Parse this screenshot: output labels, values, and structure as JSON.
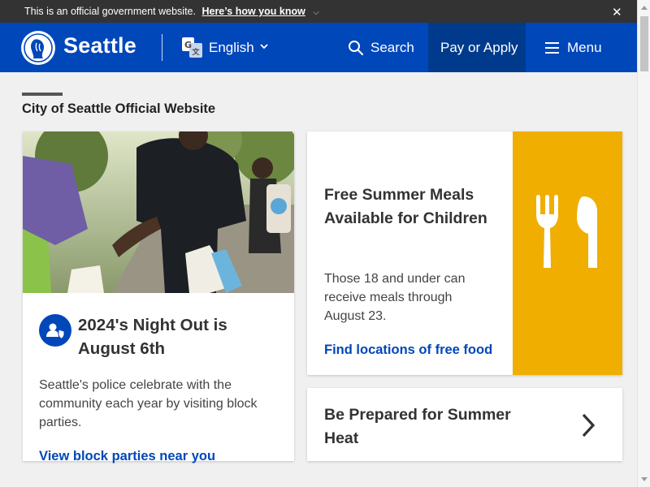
{
  "gov_banner": {
    "notice": "This is an official government website.",
    "how_link": "Here’s how you know",
    "chevron_icon": "chevron-down-icon",
    "close_glyph": "✕"
  },
  "header": {
    "logo_text": "Seattle",
    "language": "English",
    "search_label": "Search",
    "pay_label": "Pay or Apply",
    "menu_label": "Menu"
  },
  "main": {
    "section_title": "City of Seattle Official Website",
    "cards": [
      {
        "title": "2024's Night Out is August 6th",
        "description": "Seattle's police celebrate with the community each year by visiting block parties.",
        "link": "View block parties near you",
        "icon": "community-police-icon"
      },
      {
        "title": "Free Summer Meals Available for Children",
        "description": "Those 18 and under can receive meals through August 23.",
        "link": "Find locations of free food",
        "icon": "fork-knife-icon"
      },
      {
        "title": "Be Prepared for Summer Heat",
        "icon": "chevron-right-icon"
      }
    ]
  },
  "colors": {
    "brand_blue": "#0047ba",
    "pay_bg": "#003a8c",
    "banner_bg": "#333333",
    "meals_accent": "#efae00",
    "page_bg": "#f0f0f0"
  }
}
